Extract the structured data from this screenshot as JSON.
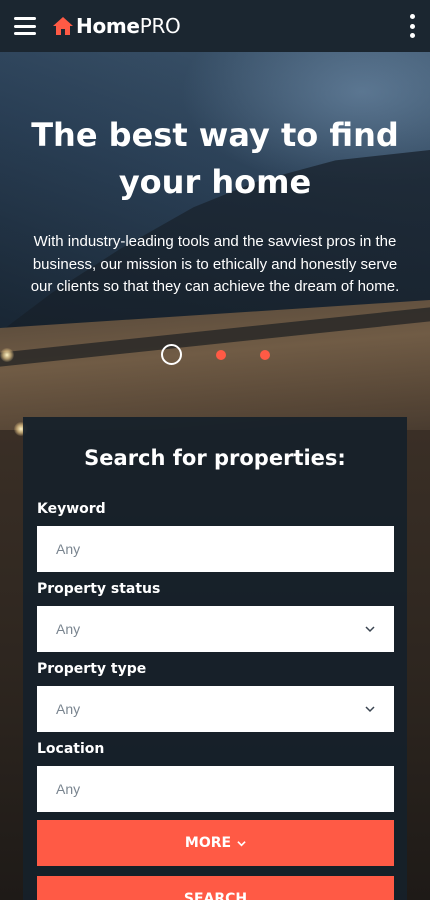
{
  "app": {
    "brand_bold": "Home",
    "brand_light": "PRO"
  },
  "hero": {
    "title": "The best way to find your home",
    "subtitle": "With industry-leading tools and the savviest pros in the business, our mission is to ethically and honestly serve our clients so that they can achieve the dream of home.",
    "slides_count": 3,
    "active_slide": 1
  },
  "search": {
    "title": "Search for properties:",
    "keyword": {
      "label": "Keyword",
      "placeholder": "Any"
    },
    "status": {
      "label": "Property status",
      "value": "Any"
    },
    "type": {
      "label": "Property type",
      "value": "Any"
    },
    "location": {
      "label": "Location",
      "placeholder": "Any"
    },
    "more_label": "MORE",
    "search_label": "SEARCH"
  },
  "colors": {
    "accent": "#ff5a45",
    "topbar": "#1b2630",
    "panel": "#16202a"
  },
  "icons": {
    "menu": "hamburger-icon",
    "logo": "house-icon",
    "overflow": "kebab-icon",
    "dropdown": "chevron-down-icon"
  }
}
